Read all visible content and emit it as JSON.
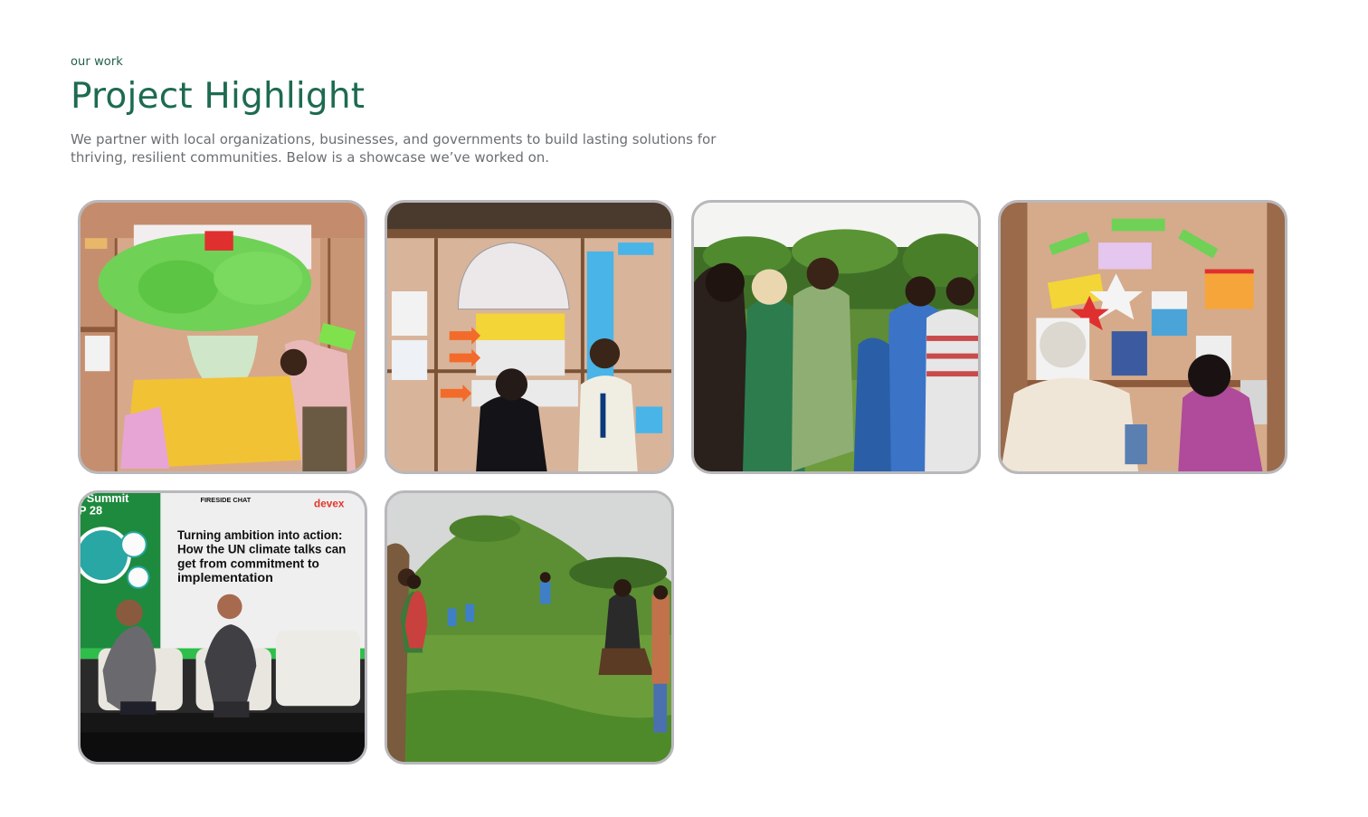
{
  "header": {
    "eyebrow": "our work",
    "title": "Project Highlight",
    "description": "We partner with local organizations, businesses, and governments to build lasting solutions for thriving, resilient communities. Below is a showcase we’ve worked on."
  },
  "gallery": {
    "photos": [
      {
        "icon": "workshop-tree-poster-photo"
      },
      {
        "icon": "workshop-board-discussion-photo"
      },
      {
        "icon": "field-visit-group-photo"
      },
      {
        "icon": "workshop-wall-display-photo"
      },
      {
        "icon": "fireside-chat-stage-photo",
        "summit_text": "x Summit",
        "summit_sub": "P 28",
        "tag": "FIRESIDE CHAT",
        "brand": "devex",
        "headline_lines": [
          "Turning ambition into action:",
          "How the UN climate talks can",
          "get from commitment to",
          "implementation"
        ]
      },
      {
        "icon": "hillside-field-group-photo"
      }
    ]
  },
  "colors": {
    "accent": "#1d6b50",
    "card_border": "#b8b8bc",
    "body_text": "#6b6f73"
  }
}
